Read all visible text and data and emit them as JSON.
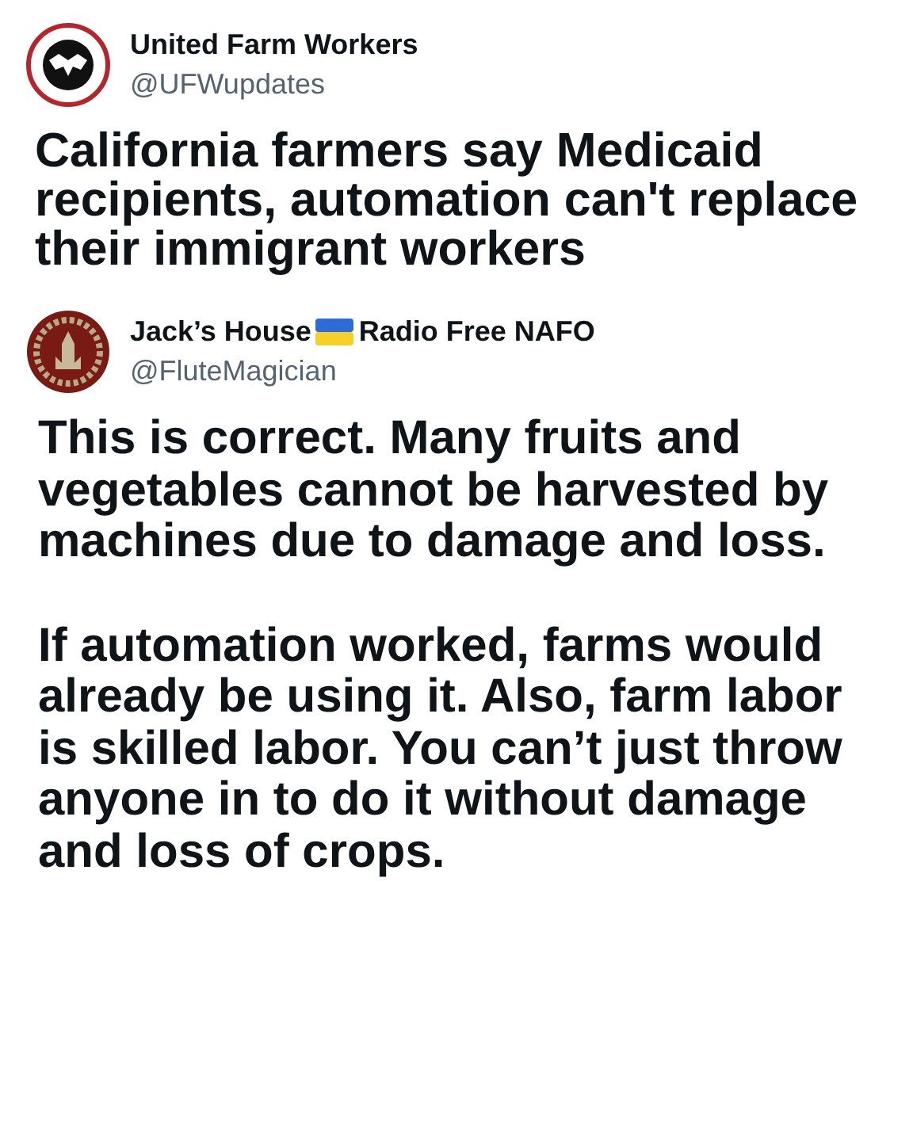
{
  "posts": [
    {
      "author": {
        "kind": "ring",
        "name_before": "United Farm Workers",
        "flag": false,
        "handle": "@UFWupdates"
      },
      "paragraphs": [
        "California farmers say Medicaid recipients, automation can't replace their immigrant workers"
      ]
    },
    {
      "author": {
        "kind": "seal",
        "name_before": "Jack’s House",
        "name_after": "Radio Free NAFO",
        "flag": true,
        "handle": "@FluteMagician"
      },
      "paragraphs": [
        "This is correct. Many fruits and vegetables cannot be harvested by machines due to damage and loss.",
        "If automation worked, farms would already be using it. Also, farm labor is skilled labor. You can’t just throw anyone in to do it without damage and loss of crops."
      ]
    }
  ]
}
